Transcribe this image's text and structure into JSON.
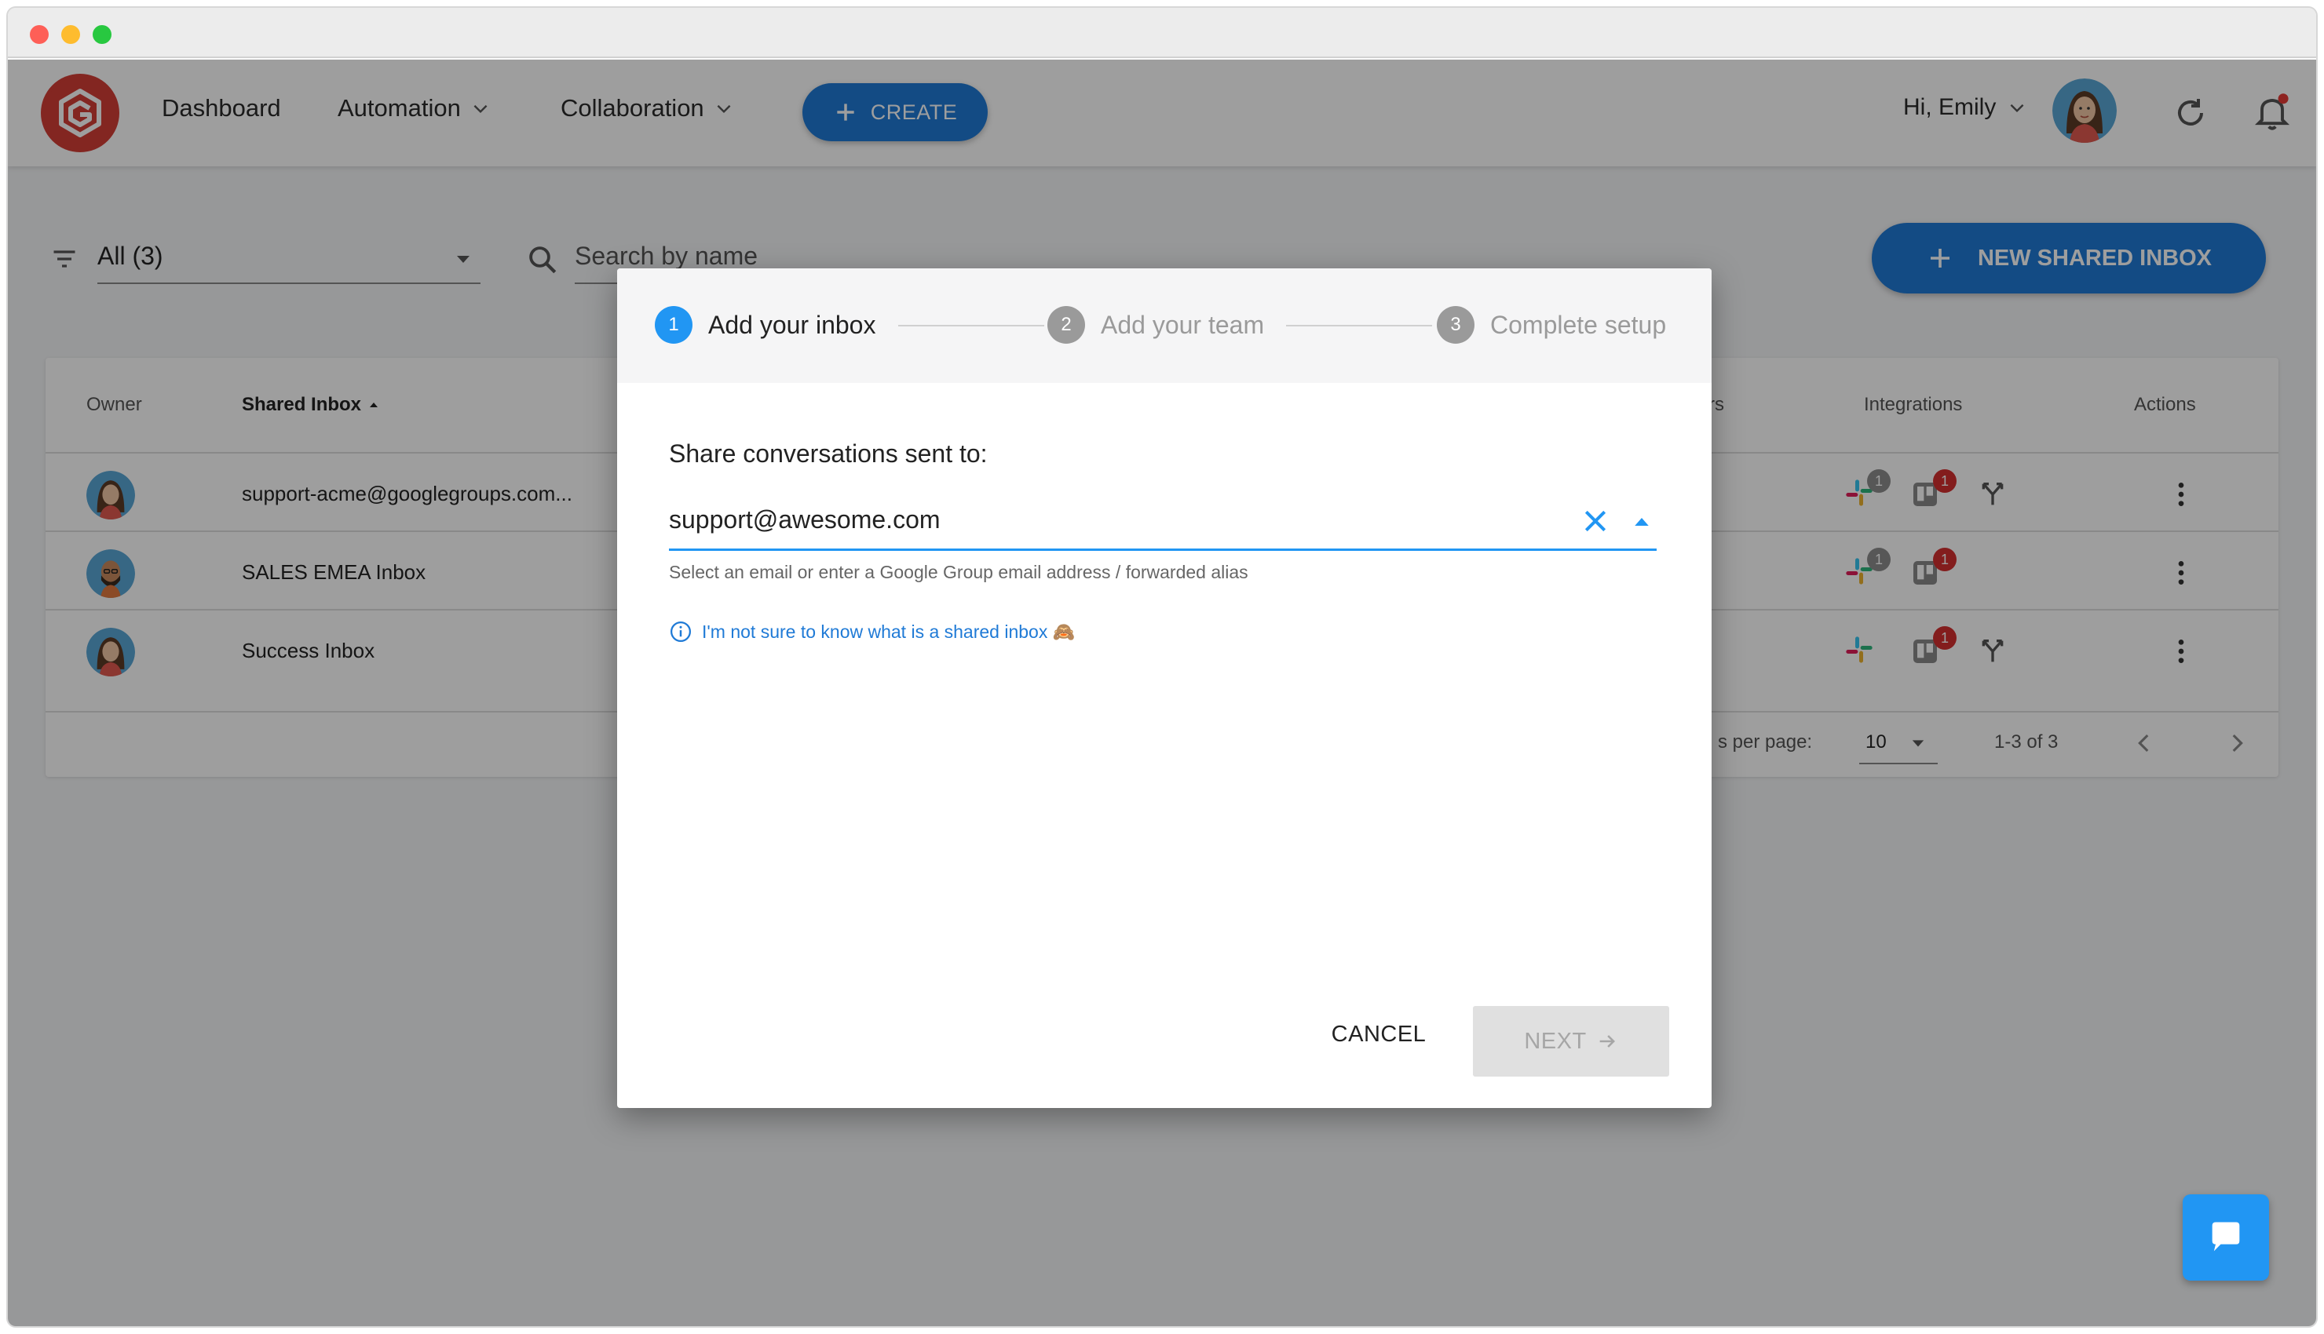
{
  "nav": {
    "dashboard": "Dashboard",
    "automation": "Automation",
    "collaboration": "Collaboration",
    "create": "CREATE",
    "greeting": "Hi, Emily"
  },
  "toolbar": {
    "filter_value": "All (3)",
    "search_placeholder": "Search by name",
    "new_inbox": "NEW SHARED INBOX"
  },
  "table": {
    "headers": {
      "owner": "Owner",
      "shared_inbox": "Shared Inbox",
      "members_partial": "rs",
      "integrations": "Integrations",
      "actions": "Actions"
    },
    "rows": [
      {
        "name": "support-acme@googlegroups.com...",
        "slack_badge": "1",
        "trello_badge": "1",
        "has_branch": true
      },
      {
        "name": "SALES EMEA Inbox",
        "slack_badge": "1",
        "trello_badge": "1",
        "has_branch": false
      },
      {
        "name": "Success Inbox",
        "slack_badge": "",
        "trello_badge": "1",
        "has_branch": true
      }
    ],
    "pager": {
      "rows_label": "s per page:",
      "rows_value": "10",
      "range": "1-3 of 3"
    }
  },
  "dialog": {
    "steps": [
      {
        "num": "1",
        "label": "Add your inbox"
      },
      {
        "num": "2",
        "label": "Add your team"
      },
      {
        "num": "3",
        "label": "Complete setup"
      }
    ],
    "share_label": "Share conversations sent to:",
    "email_value": "support@awesome.com",
    "helper": "Select an email or enter a Google Group email address / forwarded alias",
    "info_link": "I'm not sure to know what is a shared inbox 🙈",
    "cancel": "CANCEL",
    "next": "NEXT"
  },
  "colors": {
    "accent": "#1f7ad6",
    "active_step": "#2196f3",
    "brand": "#d33e36",
    "badge": "#d32f2f"
  }
}
